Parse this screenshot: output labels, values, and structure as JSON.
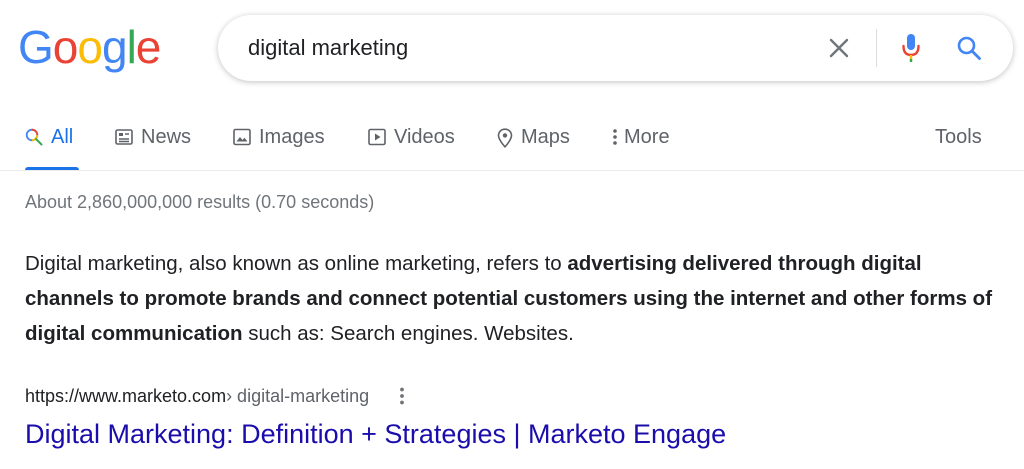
{
  "logo": {
    "letters": [
      "G",
      "o",
      "o",
      "g",
      "l",
      "e"
    ],
    "colors": [
      "#4285F4",
      "#EA4335",
      "#FBBC05",
      "#4285F4",
      "#34A853",
      "#EA4335"
    ]
  },
  "search": {
    "query": "digital marketing",
    "clear_icon": "close-icon",
    "mic_icon": "microphone-icon",
    "search_icon": "search-icon"
  },
  "tabs": [
    {
      "label": "All",
      "icon": "search-icon",
      "active": true
    },
    {
      "label": "News",
      "icon": "newspaper-icon",
      "active": false
    },
    {
      "label": "Images",
      "icon": "image-icon",
      "active": false
    },
    {
      "label": "Videos",
      "icon": "play-icon",
      "active": false
    },
    {
      "label": "Maps",
      "icon": "map-pin-icon",
      "active": false
    },
    {
      "label": "More",
      "icon": "vertical-dots-icon",
      "active": false
    }
  ],
  "tools_label": "Tools",
  "result_stats": "About 2,860,000,000 results (0.70 seconds)",
  "snippet": {
    "part1": "Digital marketing, also known as online marketing, refers to ",
    "bold": "advertising delivered through digital channels to promote brands and connect potential customers using the internet and other forms of digital communication",
    "part2": " such as: Search engines. Websites."
  },
  "result": {
    "cite_host": "https://www.marketo.com",
    "cite_path": " › digital-marketing",
    "title": "Digital Marketing: Definition + Strategies | Marketo Engage"
  },
  "colors": {
    "accent": "#1a73e8",
    "link": "#1a0dab",
    "muted": "#70757a",
    "text": "#202124"
  }
}
